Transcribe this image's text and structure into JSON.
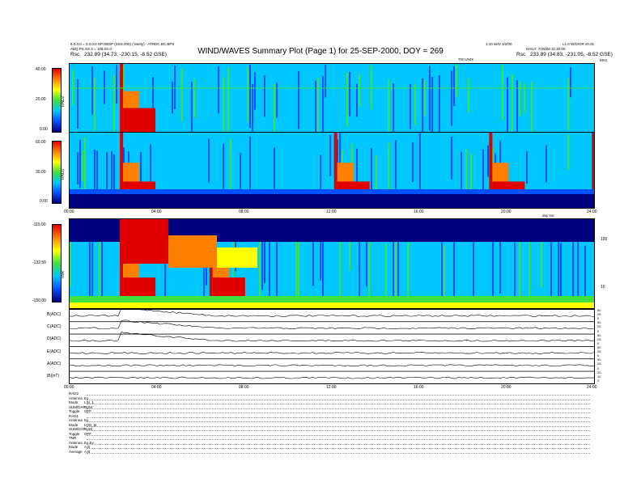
{
  "header": {
    "title": "WIND/WAVES Summary Plot (Page 1) for 25-SEP-2000, DOY = 269",
    "top_left_1": "6.0.0.0 = 2.0.0.0 SP.OBSP (SSS.000) (Yarely) - ATRDC.BC.BPS",
    "top_left_2": "ABQ.PS.SS.3 = 105.0S.0",
    "rsc_left_label": "Rsc",
    "rsc_left_value": "232.89 (34.73, -230.15, -8.52 GSE)",
    "top_right_1": "1.10 W/D 3/2/00",
    "top_right_2": "L1.0 W/D/OR v0.01",
    "top_right_3": "DAILY: 7/25/00 11:30:00",
    "rsc_right_label": "Rsc",
    "rsc_right_value": "233.89 (34.83, -231.05, -8.52 GSE)",
    "scale_label": "TIS UNIX",
    "scale_label_right": "MHz",
    "lower_scale_label": "day:ssc"
  },
  "chart_data": [
    {
      "type": "heatmap",
      "name": "RAD2",
      "ylabel": "RAD2",
      "colorbar_ticks": [
        "40.00",
        "20.00",
        "0.00"
      ],
      "y_range": [
        0,
        40
      ],
      "x_range_hours": [
        0,
        24
      ],
      "features": [
        {
          "kind": "burst",
          "hour": 2.3
        },
        {
          "kind": "horizontal_line",
          "relative_y": 0.35
        }
      ]
    },
    {
      "type": "heatmap",
      "name": "RAD1",
      "ylabel": "RAD1",
      "colorbar_ticks": [
        "60.00",
        "30.00",
        "0.00"
      ],
      "y_range": [
        0,
        60
      ],
      "x_range_hours": [
        0,
        24
      ],
      "x_tick_labels": [
        "00:00",
        "04:00",
        "08:00",
        "12:00",
        "16:00",
        "20:00",
        "24:00"
      ],
      "features": [
        {
          "kind": "burst",
          "hour": 2.3
        },
        {
          "kind": "burst",
          "hour": 12.1
        },
        {
          "kind": "burst",
          "hour": 19.2
        },
        {
          "kind": "burst",
          "hour": 23.9
        }
      ]
    },
    {
      "type": "heatmap",
      "name": "TNR",
      "ylabel": "TNR",
      "colorbar_ticks": [
        "-115.00",
        "-132.50",
        "-150.00"
      ],
      "y_range": [
        -150,
        -115
      ],
      "right_axis_ticks": [
        "100",
        "10"
      ],
      "x_range_hours": [
        0,
        24
      ],
      "features": [
        {
          "kind": "burst",
          "hour": 2.3
        },
        {
          "kind": "burst",
          "hour": 6.4
        }
      ]
    },
    {
      "type": "line",
      "name": "stacked_rate_panels",
      "x_range_hours": [
        0,
        24
      ],
      "x_tick_labels": [
        "00:00",
        "04:00",
        "08:00",
        "12:00",
        "16:00",
        "20:00",
        "24:00"
      ],
      "series": [
        {
          "name": "B(ADC)",
          "right_ticks": [
            "50",
            "25",
            "0"
          ]
        },
        {
          "name": "C(ADC)",
          "right_ticks": [
            "50",
            "25",
            "0"
          ]
        },
        {
          "name": "D(ADC)",
          "right_ticks": [
            "50",
            "25",
            "0"
          ]
        },
        {
          "name": "E(ADC)",
          "right_ticks": [
            "50",
            "25",
            "0"
          ]
        },
        {
          "name": "A(ADC)",
          "right_ticks": [
            "50",
            "25",
            "0"
          ]
        },
        {
          "name": "|B|(nT)",
          "right_ticks": [
            "20",
            "10",
            "0"
          ]
        }
      ]
    }
  ],
  "params": [
    {
      "k": "RAD2",
      "v": ""
    },
    {
      "k": "Antenna",
      "v": "Ex"
    },
    {
      "k": "Mode",
      "v": "LIN_1"
    },
    {
      "k": "SUM/DAP",
      "v": "SUM"
    },
    {
      "k": "Toggle",
      "v": "OFF"
    },
    {
      "k": "RAD1",
      "v": ""
    },
    {
      "k": "Antenna",
      "v": "Ex"
    },
    {
      "k": "Mode",
      "v": "LOG_B"
    },
    {
      "k": "SUM/DAP",
      "v": "SUM"
    },
    {
      "k": "Toggle",
      "v": "OFF"
    },
    {
      "k": "TNR",
      "v": ""
    },
    {
      "k": "Antenna",
      "v": "Ex,Ey"
    },
    {
      "k": "Mode",
      "v": "A,B"
    },
    {
      "k": "Average",
      "v": "A,B"
    }
  ],
  "colors": {
    "blue_dark": "#00007f",
    "blue": "#0050ff",
    "cyan": "#00c8ff",
    "green": "#40e040",
    "yellow": "#ffff00",
    "orange": "#ff8000",
    "red": "#e00000"
  }
}
